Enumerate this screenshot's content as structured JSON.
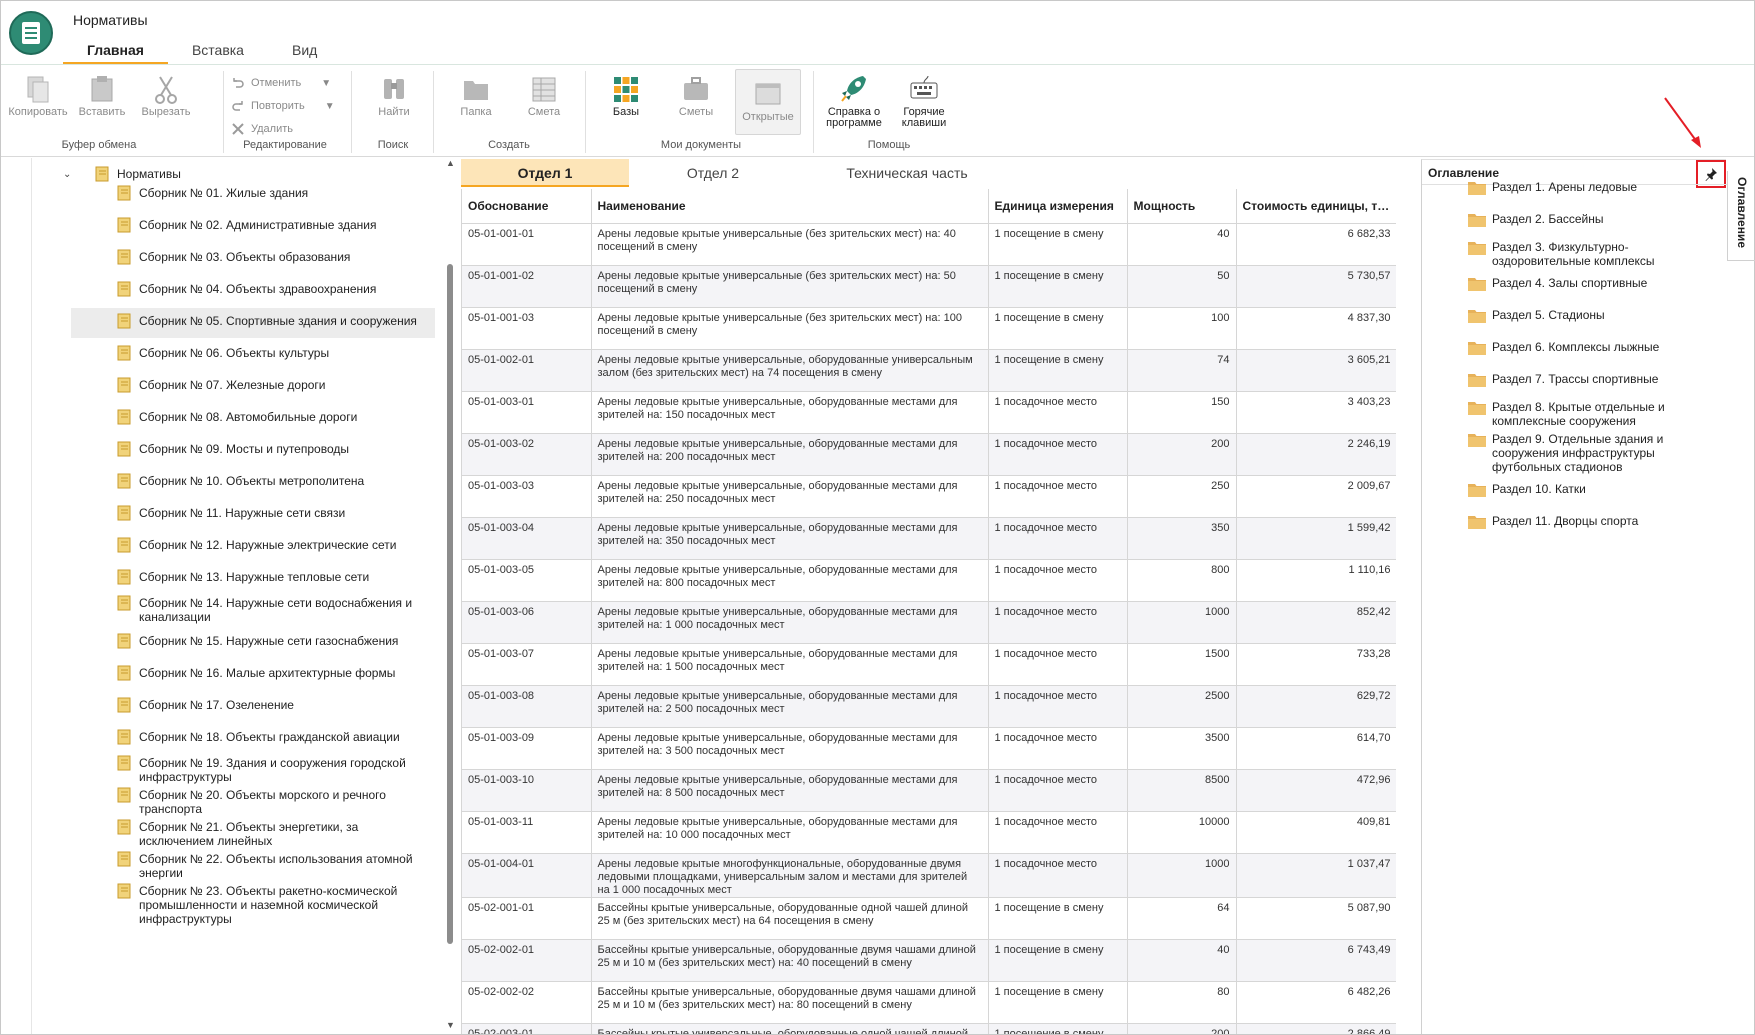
{
  "app": {
    "title": "Нормативы"
  },
  "main_tabs": [
    {
      "label": "Главная",
      "active": true
    },
    {
      "label": "Вставка",
      "active": false
    },
    {
      "label": "Вид",
      "active": false
    }
  ],
  "ribbon": {
    "clipboard": {
      "label": "Буфер обмена",
      "copy": "Копировать",
      "paste": "Вставить",
      "cut": "Вырезать"
    },
    "editing": {
      "label": "Редактирование",
      "undo": "Отменить",
      "redo": "Повторить",
      "delete": "Удалить"
    },
    "search": {
      "label": "Поиск",
      "find": "Найти"
    },
    "create": {
      "label": "Создать",
      "folder": "Папка",
      "estimate": "Смета"
    },
    "my_docs": {
      "label": "Мои документы",
      "bases": "Базы",
      "estimates": "Сметы",
      "opened": "Открытые"
    },
    "help": {
      "label": "Помощь",
      "about_1": "Справка о",
      "about_2": "программе",
      "hotkeys_1": "Горячие",
      "hotkeys_2": "клавиши"
    }
  },
  "tree": {
    "root": "Нормативы",
    "items": [
      "Сборник № 01. Жилые здания",
      "Сборник № 02. Административные здания",
      "Сборник № 03. Объекты образования",
      "Сборник № 04. Объекты здравоохранения",
      "Сборник № 05. Спортивные здания и сооружения",
      "Сборник № 06. Объекты культуры",
      "Сборник № 07. Железные дороги",
      "Сборник № 08. Автомобильные дороги",
      "Сборник № 09. Мосты и путепроводы",
      "Сборник № 10. Объекты метрополитена",
      "Сборник № 11. Наружные сети связи",
      "Сборник № 12. Наружные электрические сети",
      "Сборник № 13. Наружные тепловые сети",
      "Сборник № 14. Наружные сети водоснабжения и канализации",
      "Сборник № 15. Наружные сети газоснабжения",
      "Сборник № 16. Малые архитектурные формы",
      "Сборник № 17. Озеленение",
      "Сборник № 18. Объекты гражданской авиации",
      "Сборник № 19. Здания и сооружения городской инфраструктуры",
      "Сборник № 20. Объекты морского и речного транспорта",
      "Сборник № 21. Объекты энергетики, за исключением линейных",
      "Сборник № 22. Объекты использования атомной энергии",
      "Сборник № 23. Объекты ракетно-космической промышленности и наземной космической инфраструктуры"
    ],
    "selected_index": 4
  },
  "sheet_tabs": [
    {
      "label": "Отдел 1",
      "active": true
    },
    {
      "label": "Отдел 2",
      "active": false
    },
    {
      "label": "Техническая часть",
      "active": false
    }
  ],
  "table": {
    "columns": [
      "Обоснование",
      "Наименование",
      "Единица измерения",
      "Мощность",
      "Стоимость единицы, ты…"
    ],
    "rows": [
      [
        "05-01-001-01",
        "Арены ледовые крытые универсальные (без зрительских мест) на: 40 посещений в смену",
        "1 посещение в смену",
        "40",
        "6 682,33"
      ],
      [
        "05-01-001-02",
        "Арены ледовые крытые универсальные (без зрительских мест) на: 50 посещений в смену",
        "1 посещение в смену",
        "50",
        "5 730,57"
      ],
      [
        "05-01-001-03",
        "Арены ледовые крытые универсальные (без зрительских мест) на: 100 посещений в смену",
        "1 посещение в смену",
        "100",
        "4 837,30"
      ],
      [
        "05-01-002-01",
        "Арены ледовые крытые универсальные, оборудованные универсальным залом (без зрительских мест) на 74 посещения в смену",
        "1 посещение в смену",
        "74",
        "3 605,21"
      ],
      [
        "05-01-003-01",
        "Арены ледовые крытые универсальные, оборудованные местами для зрителей на: 150 посадочных мест",
        "1 посадочное место",
        "150",
        "3 403,23"
      ],
      [
        "05-01-003-02",
        "Арены ледовые крытые универсальные, оборудованные местами для зрителей на: 200 посадочных мест",
        "1 посадочное место",
        "200",
        "2 246,19"
      ],
      [
        "05-01-003-03",
        "Арены ледовые крытые универсальные, оборудованные местами для зрителей на: 250 посадочных мест",
        "1 посадочное место",
        "250",
        "2 009,67"
      ],
      [
        "05-01-003-04",
        "Арены ледовые крытые универсальные, оборудованные местами для зрителей на: 350 посадочных мест",
        "1 посадочное место",
        "350",
        "1 599,42"
      ],
      [
        "05-01-003-05",
        "Арены ледовые крытые универсальные, оборудованные местами для зрителей на: 800 посадочных мест",
        "1 посадочное место",
        "800",
        "1 110,16"
      ],
      [
        "05-01-003-06",
        "Арены ледовые крытые универсальные, оборудованные местами для зрителей на: 1 000 посадочных мест",
        "1 посадочное место",
        "1000",
        "852,42"
      ],
      [
        "05-01-003-07",
        "Арены ледовые крытые универсальные, оборудованные местами для зрителей на: 1 500 посадочных мест",
        "1 посадочное место",
        "1500",
        "733,28"
      ],
      [
        "05-01-003-08",
        "Арены ледовые крытые универсальные, оборудованные местами для зрителей на: 2 500 посадочных мест",
        "1 посадочное место",
        "2500",
        "629,72"
      ],
      [
        "05-01-003-09",
        "Арены ледовые крытые универсальные, оборудованные местами для зрителей на: 3 500 посадочных мест",
        "1 посадочное место",
        "3500",
        "614,70"
      ],
      [
        "05-01-003-10",
        "Арены ледовые крытые универсальные, оборудованные местами для зрителей на: 8 500 посадочных мест",
        "1 посадочное место",
        "8500",
        "472,96"
      ],
      [
        "05-01-003-11",
        "Арены ледовые крытые универсальные, оборудованные местами для зрителей на: 10 000 посадочных мест",
        "1 посадочное место",
        "10000",
        "409,81"
      ],
      [
        "05-01-004-01",
        "Арены ледовые крытые многофункциональные, оборудованные двумя ледовыми площадками, универсальным залом и местами для зрителей на 1 000 посадочных мест",
        "1 посадочное место",
        "1000",
        "1 037,47"
      ],
      [
        "05-02-001-01",
        "Бассейны крытые универсальные, оборудованные одной чашей длиной 25 м (без зрительских мест) на 64 посещения в смену",
        "1 посещение в смену",
        "64",
        "5 087,90"
      ],
      [
        "05-02-002-01",
        "Бассейны крытые универсальные, оборудованные двумя чашами длиной 25 м и 10 м (без зрительских мест) на: 40 посещений в смену",
        "1 посещение в смену",
        "40",
        "6 743,49"
      ],
      [
        "05-02-002-02",
        "Бассейны крытые универсальные, оборудованные двумя чашами длиной 25 м и 10 м (без зрительских мест) на: 80 посещений в смену",
        "1 посещение в смену",
        "80",
        "6 482,26"
      ],
      [
        "05-02-003-01",
        "Бассейны крытые универсальные, оборудованные одной чашей длиной",
        "1 посещение в смену",
        "200",
        "2 866,49"
      ]
    ]
  },
  "toc": {
    "title": "Оглавление",
    "side_tab": "Оглавление",
    "items": [
      "Раздел 1. Арены ледовые",
      "Раздел 2. Бассейны",
      "Раздел 3. Физкультурно-оздоровительные комплексы",
      "Раздел 4. Залы спортивные",
      "Раздел 5. Стадионы",
      "Раздел 6. Комплексы лыжные",
      "Раздел 7. Трассы спортивные",
      "Раздел 8. Крытые отдельные и комплексные сооружения",
      "Раздел 9. Отдельные здания и сооружения инфраструктуры футбольных стадионов",
      "Раздел 10. Катки",
      "Раздел 11. Дворцы спорта"
    ]
  },
  "colors": {
    "accent": "#f5a623",
    "brand": "#2e8b74",
    "highlight": "#e41e26",
    "folder": "#e7b25a"
  }
}
